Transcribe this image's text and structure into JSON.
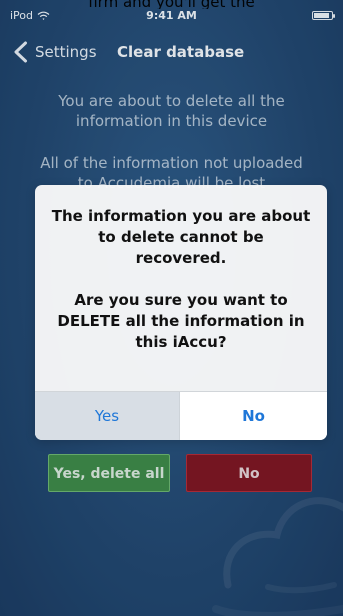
{
  "caption": {
    "text": "firm and you'll get the"
  },
  "status_bar": {
    "device": "iPod",
    "time": "9:41 AM",
    "wifi_icon": "wifi-icon",
    "battery_icon": "battery-icon"
  },
  "nav_bar": {
    "back_label": "Settings",
    "back_icon": "chevron-left-icon",
    "title": "Clear database"
  },
  "content": {
    "warning_line_1": "You are about to delete all the",
    "warning_line_2": "information in this device",
    "loss_line_1": "All of the information not uploaded",
    "loss_line_2": "to Accudemia will be lost"
  },
  "background_actions": {
    "yes_label": "Yes, delete all",
    "no_label": "No",
    "yes_color": "#3e8a46",
    "no_color": "#7f141f"
  },
  "alert": {
    "line_1": "The information you are about",
    "line_2": "to delete cannot be",
    "line_3": "recovered.",
    "line_4": "Are you sure you want to",
    "line_5": "DELETE all the information in",
    "line_6": "this iAccu?",
    "yes_label": "Yes",
    "no_label": "No",
    "accent_color": "#1f77d8"
  },
  "theme": {
    "background": "#244b74",
    "alert_background": "#f9f9f9"
  }
}
